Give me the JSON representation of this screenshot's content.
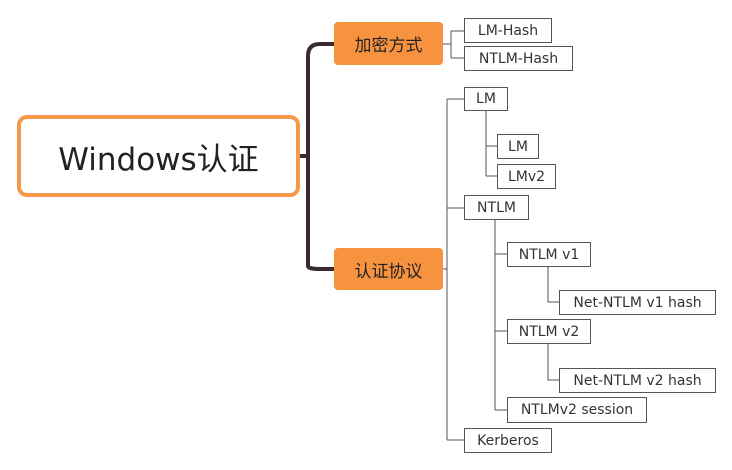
{
  "root": {
    "label": "Windows认证"
  },
  "branches": [
    {
      "label": "加密方式",
      "children": [
        {
          "label": "LM-Hash"
        },
        {
          "label": "NTLM-Hash"
        }
      ]
    },
    {
      "label": "认证协议",
      "children": [
        {
          "label": "LM",
          "children": [
            {
              "label": "LM"
            },
            {
              "label": "LMv2"
            }
          ]
        },
        {
          "label": "NTLM",
          "children": [
            {
              "label": "NTLM v1",
              "children": [
                {
                  "label": "Net-NTLM v1 hash"
                }
              ]
            },
            {
              "label": "NTLM v2",
              "children": [
                {
                  "label": "Net-NTLM v2 hash"
                }
              ]
            },
            {
              "label": "NTLMv2 session"
            }
          ]
        },
        {
          "label": "Kerberos"
        }
      ]
    }
  ],
  "colors": {
    "branch_fill": "#f7933f",
    "root_border": "#f49a4a",
    "connector": "#3a2c2e",
    "leaf_border": "#555555"
  }
}
